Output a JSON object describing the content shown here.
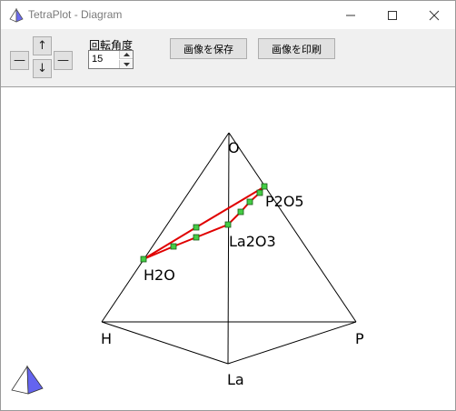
{
  "window": {
    "title": "TetraPlot - Diagram",
    "minimize_glyph": "—",
    "maximize_glyph": "☐",
    "close_glyph": "✕"
  },
  "toolbar": {
    "up_arrow": "↑",
    "down_arrow": "↓",
    "left_arrow": "—",
    "right_arrow": "—",
    "rotation_label": "回転角度",
    "rotation_value": "15",
    "save_label": "画像を保存",
    "print_label": "画像を印刷"
  },
  "diagram": {
    "vertex_labels": {
      "O": "O",
      "H": "H",
      "P": "P",
      "La": "La"
    },
    "compound_labels": {
      "P2O5": "P2O5",
      "La2O3": "La2O3",
      "H2O": "H2O"
    },
    "colors": {
      "edge": "#000000",
      "path": "#e00000",
      "marker_fill": "#44cc44",
      "marker_stroke": "#1a5a1a",
      "pyramid_light": "#ffffff",
      "pyramid_dark": "#6464f0"
    }
  }
}
